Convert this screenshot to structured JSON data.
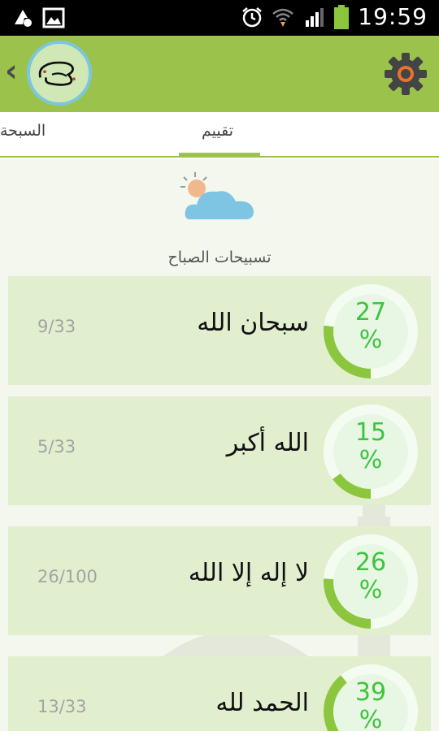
{
  "status_bar": {
    "time": "19:59",
    "icons": [
      "notification-icon",
      "image-icon",
      "alarm-icon",
      "wifi-icon",
      "signal-icon",
      "battery-icon"
    ]
  },
  "app_bar": {
    "back_icon": "chevron-left-icon",
    "logo": "app-logo",
    "settings_icon": "gear-icon",
    "color": "#9bc34c"
  },
  "tabs": [
    {
      "label": "السبحة",
      "active": false
    },
    {
      "label": "تقييم",
      "active": true
    }
  ],
  "section": {
    "title": "تسبيحات الصباح",
    "icon": "weather-sun-cloud-icon"
  },
  "rows": [
    {
      "dhikr": "سبحان الله",
      "count": "9/33",
      "percent": "27",
      "percent_sign": "%",
      "progress": 27
    },
    {
      "dhikr": "الله أكبر",
      "count": "5/33",
      "percent": "15",
      "percent_sign": "%",
      "progress": 15
    },
    {
      "dhikr": "لا إله إلا الله",
      "count": "26/100",
      "percent": "26",
      "percent_sign": "%",
      "progress": 26
    },
    {
      "dhikr": "الحمد لله",
      "count": "13/33",
      "percent": "39",
      "percent_sign": "%",
      "progress": 39
    }
  ],
  "colors": {
    "accent": "#9bc34c",
    "percent_text": "#3dc43d",
    "row_bg": "#e2efcf"
  }
}
